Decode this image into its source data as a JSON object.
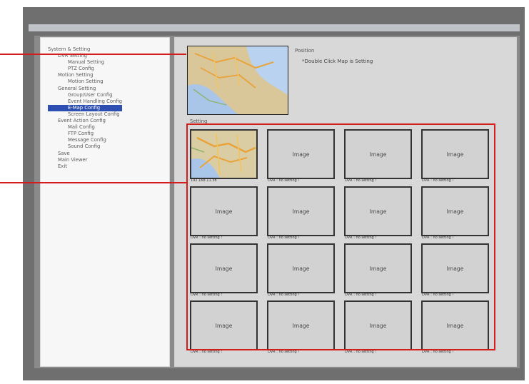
{
  "tree": {
    "items": [
      {
        "label": "System & Setting",
        "indent": 0
      },
      {
        "label": "DVR Setting",
        "indent": 1
      },
      {
        "label": "Manual Setting",
        "indent": 2
      },
      {
        "label": "PTZ Config",
        "indent": 2
      },
      {
        "label": "Motion Setting",
        "indent": 1
      },
      {
        "label": "Motion Setting",
        "indent": 2
      },
      {
        "label": "General Setting",
        "indent": 1
      },
      {
        "label": "Group/User Config",
        "indent": 2
      },
      {
        "label": "Event Handling Config",
        "indent": 2
      },
      {
        "label": "E-Map Config",
        "indent": 2,
        "selected": true
      },
      {
        "label": "Screen Layout Config",
        "indent": 2
      },
      {
        "label": "Event Action Config",
        "indent": 1
      },
      {
        "label": "Mail Config",
        "indent": 2
      },
      {
        "label": "FTP Config",
        "indent": 2
      },
      {
        "label": "Message Config",
        "indent": 2
      },
      {
        "label": "Sound Config",
        "indent": 2
      },
      {
        "label": "Save",
        "indent": 1
      },
      {
        "label": "Main Viewer",
        "indent": 1
      },
      {
        "label": "Exit",
        "indent": 1
      }
    ]
  },
  "position": {
    "label": "Position",
    "note": "*Double Click Map is Setting"
  },
  "section_label": "Setting",
  "grid": [
    {
      "text": "",
      "caption": "192.168.11.38",
      "is_map": true
    },
    {
      "text": "Image",
      "caption": "DVR : no setting !"
    },
    {
      "text": "Image",
      "caption": "DVR : no setting !"
    },
    {
      "text": "Image",
      "caption": "DVR : no setting !"
    },
    {
      "text": "Image",
      "caption": "DVR : no setting !"
    },
    {
      "text": "Image",
      "caption": "DVR : no setting !"
    },
    {
      "text": "Image",
      "caption": "DVR : no setting !"
    },
    {
      "text": "Image",
      "caption": "DVR : no setting !"
    },
    {
      "text": "Image",
      "caption": "DVR : no setting !"
    },
    {
      "text": "Image",
      "caption": "DVR : no setting !"
    },
    {
      "text": "Image",
      "caption": "DVR : no setting !"
    },
    {
      "text": "Image",
      "caption": "DVR : no setting !"
    },
    {
      "text": "Image",
      "caption": "DVR : no setting !"
    },
    {
      "text": "Image",
      "caption": "DVR : no setting !"
    },
    {
      "text": "Image",
      "caption": "DVR : no setting !"
    },
    {
      "text": "Image",
      "caption": "DVR : no setting !"
    }
  ],
  "colors": {
    "annotation": "#d31d1d",
    "selection": "#2d4fb2"
  }
}
